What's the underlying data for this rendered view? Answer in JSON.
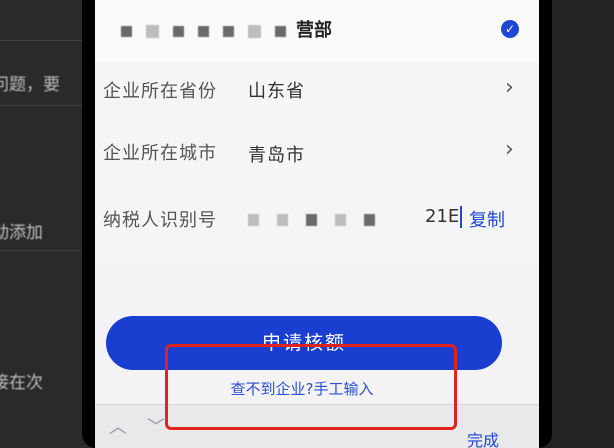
{
  "background": {
    "left_fragments": [
      "问题，要",
      "动添加",
      "接在次"
    ]
  },
  "company": {
    "name_tail": "营部",
    "selected": true
  },
  "form": {
    "province_label": "企业所在省份",
    "province_value": "山东省",
    "city_label": "企业所在城市",
    "city_value": "青岛市",
    "tax_label": "纳税人识别号",
    "tax_value_visible": "21E",
    "copy_label": "复制"
  },
  "actions": {
    "apply_label": "申请核额",
    "manual_label": "查不到企业?手工输入",
    "done_label": "完成"
  },
  "colors": {
    "accent": "#1f47d6",
    "button": "#1a3fd0",
    "highlight": "#e0241b"
  }
}
